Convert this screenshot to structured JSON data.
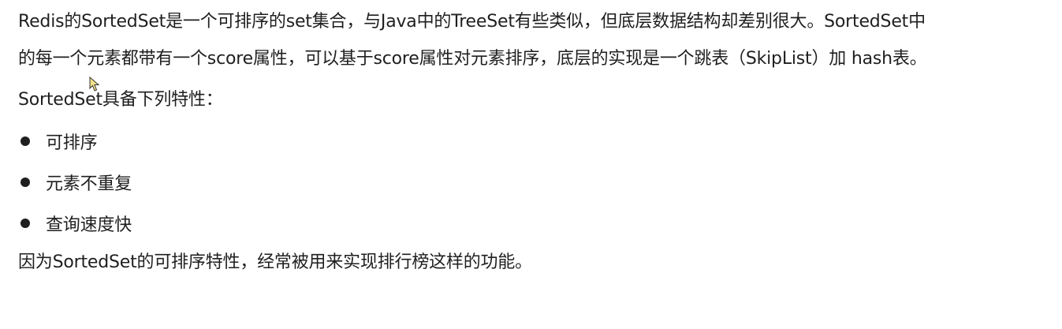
{
  "paragraphs": {
    "line1": "Redis的SortedSet是一个可排序的set集合，与Java中的TreeSet有些类似，但底层数据结构却差别很大。SortedSet中",
    "line2": "的每一个元素都带有一个score属性，可以基于score属性对元素排序，底层的实现是一个跳表（SkipList）加 hash表。",
    "features_intro": "SortedSet具备下列特性：",
    "conclusion": "因为SortedSet的可排序特性，经常被用来实现排行榜这样的功能。"
  },
  "features": [
    "可排序",
    "元素不重复",
    "查询速度快"
  ],
  "colors": {
    "text": "#1f1f1f",
    "background": "#ffffff",
    "cursor_fill": "#f2e08a"
  },
  "cursor_icon": "mouse-pointer-icon"
}
